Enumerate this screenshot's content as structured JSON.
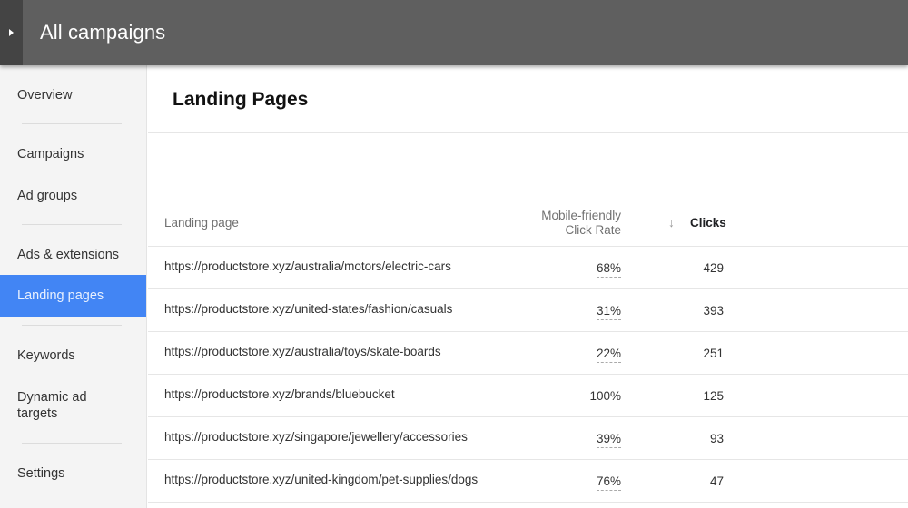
{
  "header": {
    "title": "All campaigns",
    "toggle_icon": "triangle-right-icon"
  },
  "sidebar": {
    "items": [
      {
        "label": "Overview"
      },
      {
        "label": "Campaigns"
      },
      {
        "label": "Ad groups"
      },
      {
        "label": "Ads & extensions"
      },
      {
        "label": "Landing pages",
        "active": true
      },
      {
        "label": "Keywords"
      },
      {
        "label": "Dynamic ad targets"
      },
      {
        "label": "Settings"
      }
    ]
  },
  "main": {
    "title": "Landing Pages",
    "table": {
      "columns": {
        "landing_page": "Landing page",
        "rate_line1": "Mobile-friendly",
        "rate_line2": "Click Rate",
        "clicks": "Clicks",
        "sort_icon": "arrow-down-icon"
      },
      "rows": [
        {
          "url": "https://productstore.xyz/australia/motors/electric-cars",
          "rate": "68%",
          "clicks": "429"
        },
        {
          "url": "https://productstore.xyz/united-states/fashion/casuals",
          "rate": "31%",
          "clicks": "393"
        },
        {
          "url": "https://productstore.xyz/australia/toys/skate-boards",
          "rate": "22%",
          "clicks": "251"
        },
        {
          "url": "https://productstore.xyz/brands/bluebucket",
          "rate": "100%",
          "clicks": "125"
        },
        {
          "url": "https://productstore.xyz/singapore/jewellery/accessories",
          "rate": "39%",
          "clicks": "93"
        },
        {
          "url": "https://productstore.xyz/united-kingdom/pet-supplies/dogs",
          "rate": "76%",
          "clicks": "47"
        }
      ]
    }
  },
  "colors": {
    "topbar": "#5f5f5f",
    "active_nav": "#4285f4",
    "sidebar_bg": "#f4f4f4"
  }
}
